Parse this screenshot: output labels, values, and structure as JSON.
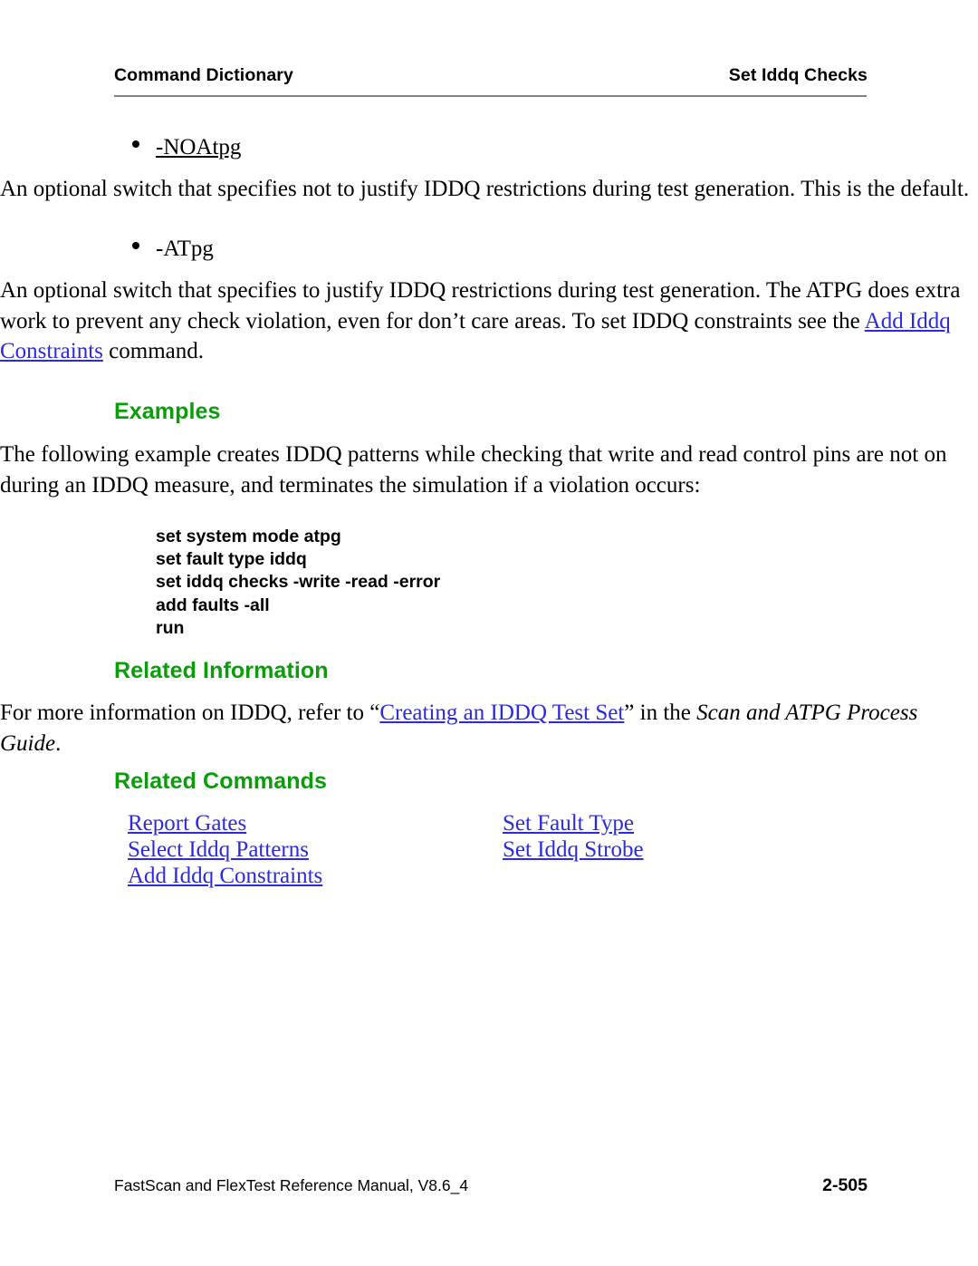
{
  "header": {
    "left": "Command Dictionary",
    "right": "Set Iddq Checks"
  },
  "switches": [
    {
      "term": "-NOAtpg",
      "description": "An optional switch that specifies not to justify IDDQ restrictions during test generation. This is the default."
    },
    {
      "term": "-ATpg",
      "desc_before": "An optional switch that specifies to justify IDDQ restrictions during test generation. The ATPG does extra work to prevent any check violation, even for don’t care areas. To set IDDQ constraints see the ",
      "link": "Add Iddq Constraints",
      "desc_after": " command."
    }
  ],
  "examples": {
    "heading": "Examples",
    "intro": "The following example creates IDDQ patterns while checking that write and read control pins are not on during an IDDQ measure, and terminates the simulation if a violation occurs:",
    "code_lines": [
      "set system mode atpg",
      "set fault type iddq",
      "set iddq checks -write -read -error",
      "add faults -all",
      "run"
    ]
  },
  "related_information": {
    "heading": "Related Information",
    "text_before": "For more information on IDDQ, refer to “",
    "link": "Creating an IDDQ Test Set",
    "text_middle": "” in the ",
    "italic_title": "Scan and ATPG Process Guide",
    "text_after": "."
  },
  "related_commands": {
    "heading": "Related Commands",
    "left_column": [
      "Report Gates",
      "Select Iddq Patterns",
      "Add Iddq Constraints"
    ],
    "right_column": [
      "Set Fault Type",
      "Set Iddq Strobe"
    ]
  },
  "footer": {
    "manual": "FastScan and FlexTest Reference Manual, V8.6_4",
    "page": "2-505"
  },
  "colors": {
    "link": "#2a2ade",
    "heading": "#0a9d0a",
    "rule": "#808080"
  }
}
